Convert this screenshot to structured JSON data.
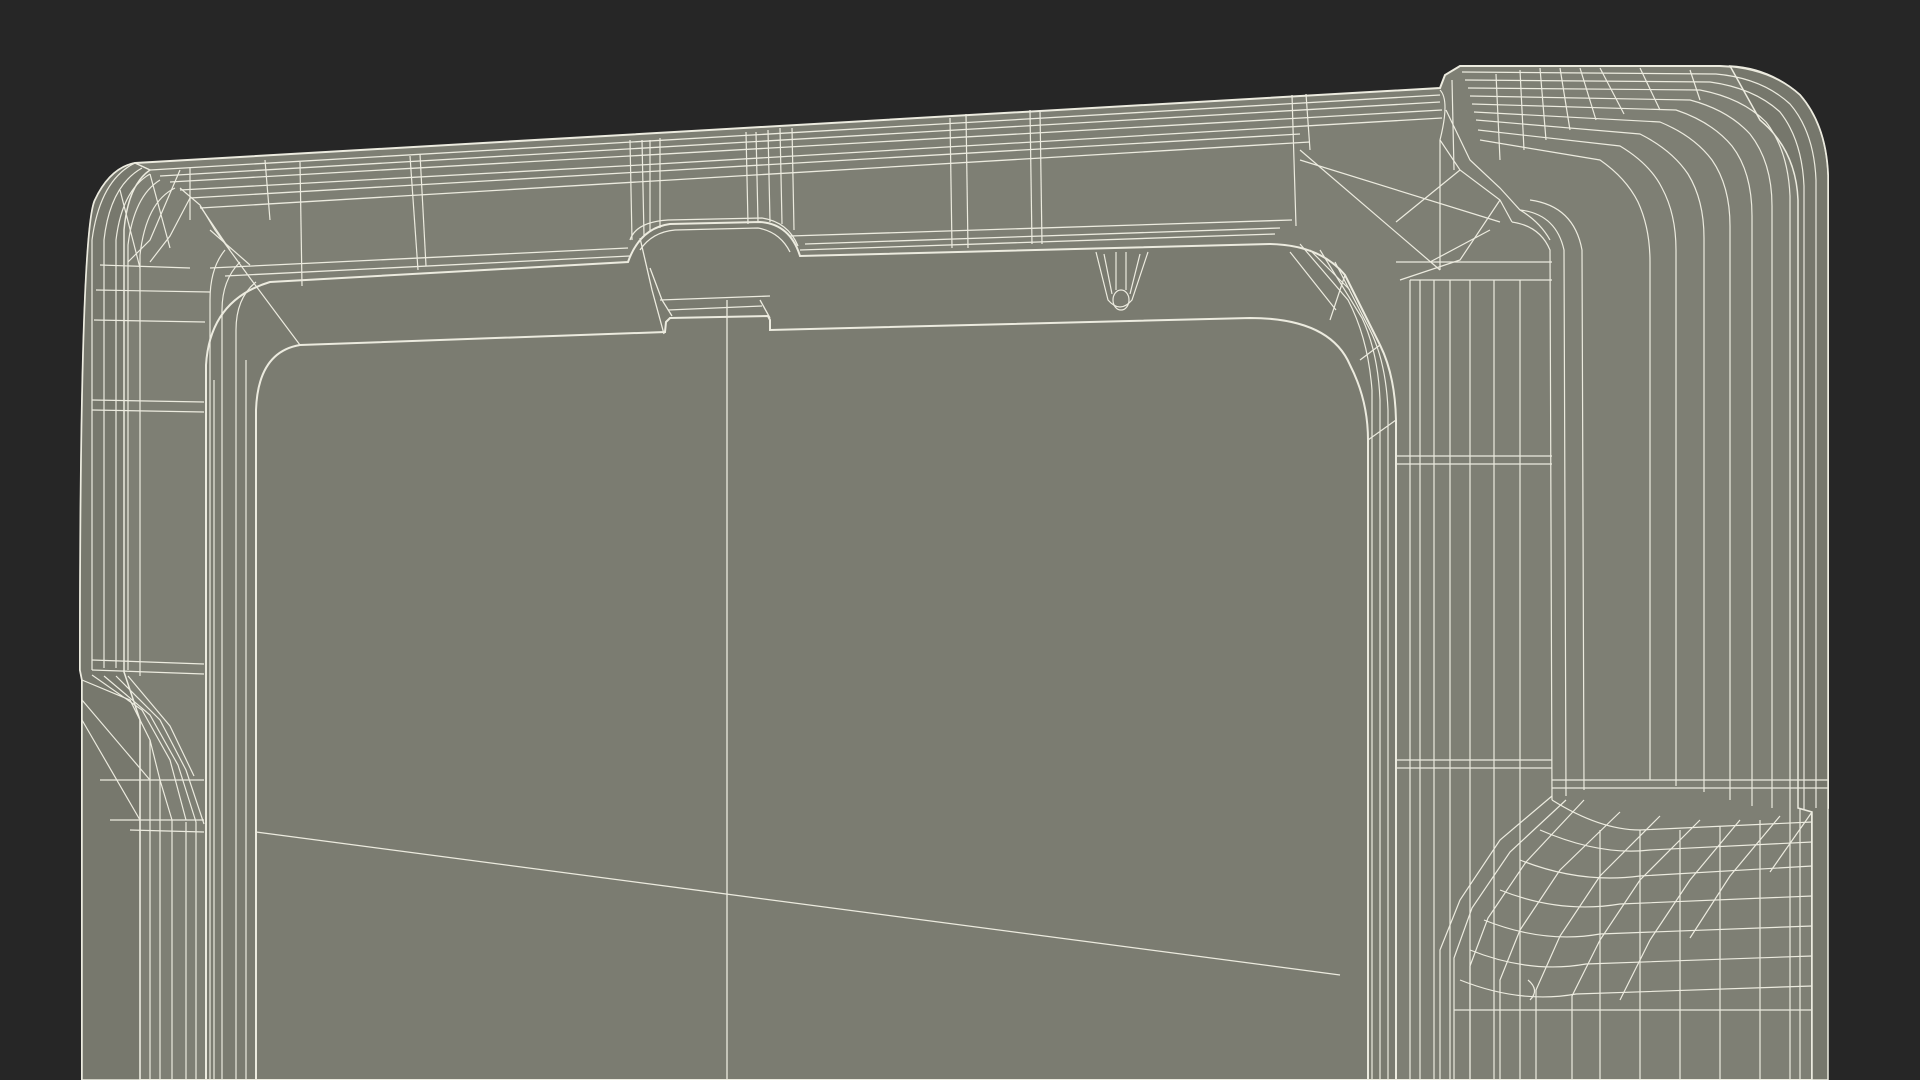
{
  "scene": {
    "subject": "wireframe-render-of-rugged-tablet-case",
    "colors": {
      "background": "#262626",
      "body": "#7e7f74",
      "body_dark": "#77786d",
      "screen": "#7b7c71",
      "wire": "#ecebdf",
      "wire_dim": "#c9c8bb",
      "shade": "#6f7066"
    }
  }
}
